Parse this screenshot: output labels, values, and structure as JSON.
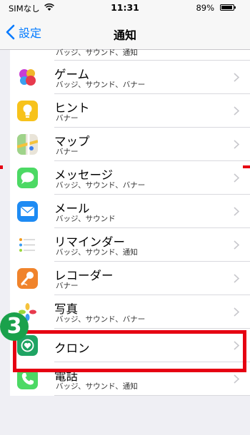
{
  "status_bar": {
    "carrier": "SIMなし",
    "time": "11:31",
    "battery_percent": "89%"
  },
  "nav": {
    "back_label": "設定",
    "title": "通知"
  },
  "list": {
    "partial_subtitle": "バッジ、サウンド、通知",
    "items": [
      {
        "title": "ゲーム",
        "subtitle": "バッジ、サウンド、バナー",
        "icon": "game-center-icon"
      },
      {
        "title": "ヒント",
        "subtitle": "バナー",
        "icon": "tips-icon"
      },
      {
        "title": "マップ",
        "subtitle": "バナー",
        "icon": "maps-icon"
      },
      {
        "title": "メッセージ",
        "subtitle": "バッジ、サウンド、バナー",
        "icon": "messages-icon"
      },
      {
        "title": "メール",
        "subtitle": "バッジ、サウンド",
        "icon": "mail-icon"
      },
      {
        "title": "リマインダー",
        "subtitle": "バッジ、サウンド、通知",
        "icon": "reminders-icon"
      },
      {
        "title": "レコーダー",
        "subtitle": "バナー",
        "icon": "recorder-icon"
      },
      {
        "title": "写真",
        "subtitle": "バッジ、サウンド、バナー",
        "icon": "photos-icon"
      },
      {
        "title": "クロン",
        "subtitle": "",
        "icon": "kuron-icon"
      },
      {
        "title": "電話",
        "subtitle": "バッジ、サウンド、通知",
        "icon": "phone-icon"
      }
    ]
  },
  "annotation": {
    "step_number": "3",
    "highlight_color": "#e60012",
    "badge_color": "#1aa14b"
  }
}
